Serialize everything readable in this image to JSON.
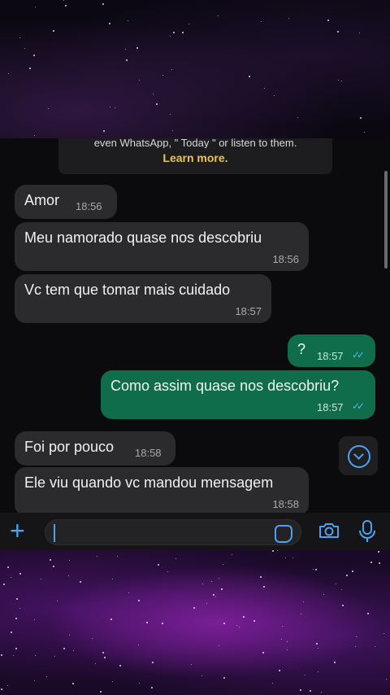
{
  "notice": {
    "cut_text": "even WhatsApp, \" Today \" or listen to them.",
    "link": "Learn more."
  },
  "messages": [
    {
      "dir": "in",
      "text": "Amor",
      "time": "18:56"
    },
    {
      "dir": "in",
      "text": "Meu namorado quase nos descobriu",
      "time": "18:56"
    },
    {
      "dir": "in",
      "text": "Vc tem que tomar mais cuidado",
      "time": "18:57"
    },
    {
      "dir": "out",
      "text": "?",
      "time": "18:57",
      "status": "read"
    },
    {
      "dir": "out",
      "text": "Como assim quase nos descobriu?",
      "time": "18:57",
      "status": "read"
    },
    {
      "dir": "in",
      "text": "Foi por pouco",
      "time": "18:58"
    },
    {
      "dir": "in",
      "text": "Ele viu quando vc mandou mensagem",
      "time": "18:58"
    }
  ],
  "input": {
    "value": "",
    "placeholder": ""
  },
  "icons": {
    "add": "plus-icon",
    "sticker": "sticker-icon",
    "camera": "camera-icon",
    "mic": "microphone-icon",
    "scroll": "chevron-down-icon",
    "read_receipt": "double-check-icon"
  },
  "colors": {
    "incoming_bubble": "#2b2b2e",
    "outgoing_bubble": "#0f6d4b",
    "accent": "#4aa3f0",
    "link": "#e8c25a"
  }
}
